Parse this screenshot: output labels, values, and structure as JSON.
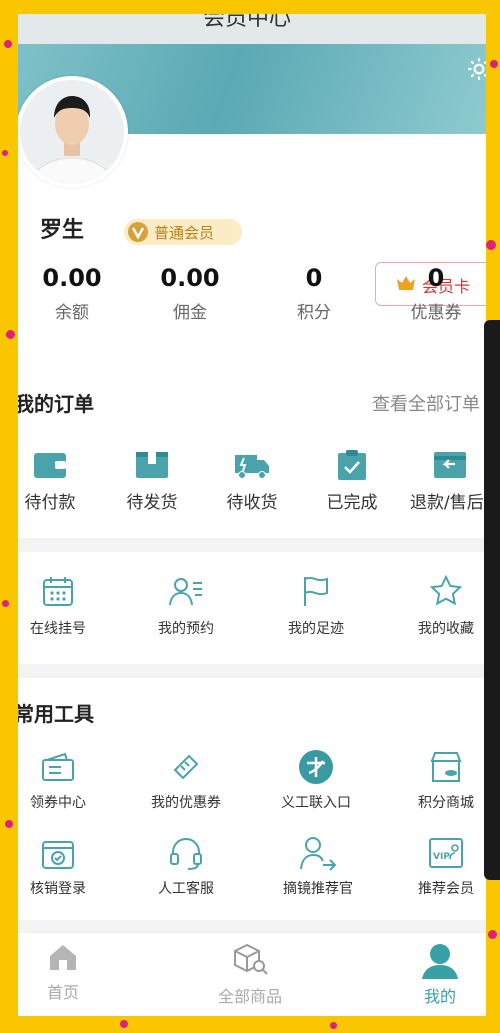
{
  "header": {
    "title": "会员中心"
  },
  "profile": {
    "name": "罗生",
    "member_level": "普通会员",
    "vip_card_label": "会员卡",
    "stats": [
      {
        "value": "0.00",
        "label": "余额"
      },
      {
        "value": "0.00",
        "label": "佣金"
      },
      {
        "value": "0",
        "label": "积分"
      },
      {
        "value": "0",
        "label": "优惠券"
      }
    ]
  },
  "orders": {
    "title": "我的订单",
    "view_all": "查看全部订单",
    "items": [
      {
        "label": "待付款",
        "icon": "wallet-icon"
      },
      {
        "label": "待发货",
        "icon": "package-icon"
      },
      {
        "label": "待收货",
        "icon": "truck-icon"
      },
      {
        "label": "已完成",
        "icon": "clipboard-check-icon"
      },
      {
        "label": "退款/售后",
        "icon": "refund-icon"
      }
    ]
  },
  "quick_links": {
    "items": [
      {
        "label": "在线挂号",
        "icon": "calendar-icon"
      },
      {
        "label": "我的预约",
        "icon": "user-list-icon"
      },
      {
        "label": "我的足迹",
        "icon": "flag-icon"
      },
      {
        "label": "我的收藏",
        "icon": "star-icon"
      }
    ]
  },
  "tools": {
    "title": "常用工具",
    "items": [
      {
        "label": "领券中心",
        "icon": "coupon-center-icon"
      },
      {
        "label": "我的优惠券",
        "icon": "ticket-icon"
      },
      {
        "label": "义工联入口",
        "icon": "volunteer-logo-icon"
      },
      {
        "label": "积分商城",
        "icon": "store-icon"
      },
      {
        "label": "核销登录",
        "icon": "verify-icon"
      },
      {
        "label": "人工客服",
        "icon": "headset-icon"
      },
      {
        "label": "摘镜推荐官",
        "icon": "user-share-icon"
      },
      {
        "label": "推荐会员",
        "icon": "vip-card-icon"
      }
    ]
  },
  "bottom_nav": {
    "items": [
      {
        "label": "首页",
        "icon": "home-icon"
      },
      {
        "label": "全部商品",
        "icon": "box-search-icon"
      },
      {
        "label": "我的",
        "icon": "user-icon"
      }
    ]
  },
  "colors": {
    "accent": "#3aa0a8",
    "background": "#f9c600",
    "vip": "#d33333"
  }
}
